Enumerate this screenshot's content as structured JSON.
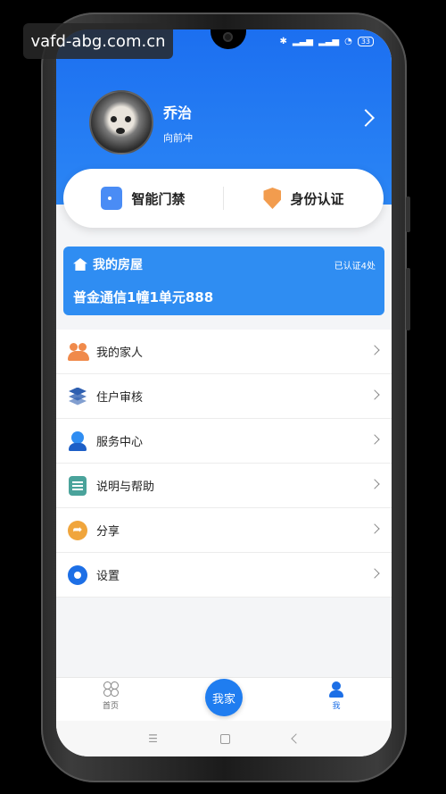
{
  "watermark": "vafd-abg.com.cn",
  "status": {
    "battery": "33"
  },
  "profile": {
    "name": "乔治",
    "motto": "向前冲"
  },
  "quick_actions": [
    {
      "label": "智能门禁",
      "icon": "door-icon"
    },
    {
      "label": "身份认证",
      "icon": "shield-icon"
    }
  ],
  "house": {
    "title": "我的房屋",
    "count": "已认证4处",
    "address": "普金通信1幢1单元888"
  },
  "menu": [
    {
      "label": "我的家人",
      "icon": "family-icon"
    },
    {
      "label": "住户审核",
      "icon": "layers-icon"
    },
    {
      "label": "服务中心",
      "icon": "service-icon"
    },
    {
      "label": "说明与帮助",
      "icon": "document-icon"
    },
    {
      "label": "分享",
      "icon": "share-icon"
    },
    {
      "label": "设置",
      "icon": "gear-icon"
    }
  ],
  "tabbar": {
    "home": "首页",
    "center": "我家",
    "me": "我"
  },
  "colors": {
    "primary": "#1c6ff0",
    "card_blue": "#2f8df2",
    "accent_orange": "#f29c4e"
  }
}
